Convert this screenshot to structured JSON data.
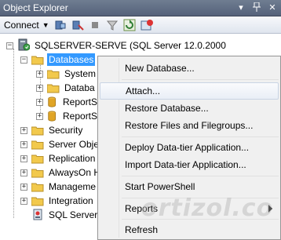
{
  "window": {
    "title": "Object Explorer"
  },
  "toolbar": {
    "connect_label": "Connect",
    "icons": [
      "connect-server-icon",
      "disconnect-icon",
      "stop-icon",
      "filter-icon",
      "refresh-icon",
      "sync-icon"
    ]
  },
  "tree": {
    "server": "SQLSERVER-SERVE (SQL Server 12.0.2000",
    "databases": "Databases",
    "db_children": [
      "System",
      "Databa",
      "ReportS",
      "ReportS"
    ],
    "nodes": [
      "Security",
      "Server Obje",
      "Replication",
      "AlwaysOn H",
      "Manageme",
      "Integration",
      "SQL Server"
    ]
  },
  "context_menu": {
    "items": [
      "New Database...",
      "Attach...",
      "Restore Database...",
      "Restore Files and Filegroups...",
      "Deploy Data-tier Application...",
      "Import Data-tier Application...",
      "Start PowerShell",
      "Reports",
      "Refresh"
    ]
  },
  "watermark": "ortizol.co",
  "colors": {
    "selection": "#3399ff",
    "folder": "#f2c94c",
    "db": "#e0a526",
    "titlebar": "#5f6c83"
  }
}
